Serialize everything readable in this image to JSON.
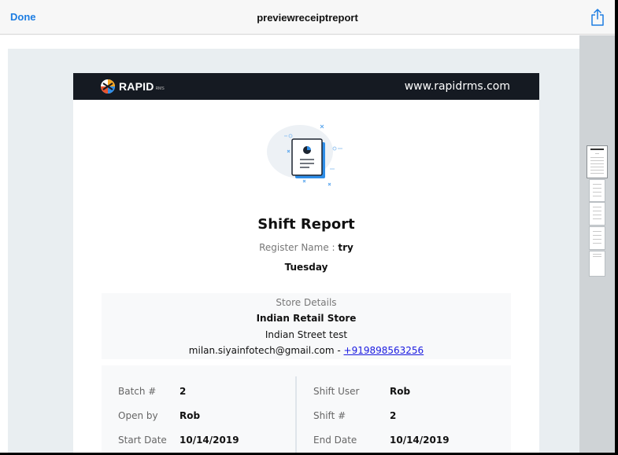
{
  "nav": {
    "done_label": "Done",
    "title": "previewreceiptreport",
    "share_icon": "share-icon"
  },
  "brand": {
    "logo_text": "RAPID",
    "logo_sub": "RMS",
    "website": "www.rapidrms.com"
  },
  "report": {
    "title": "Shift Report",
    "register_label": "Register Name :",
    "register_name": "try",
    "day": "Tuesday"
  },
  "store": {
    "heading": "Store Details",
    "name": "Indian Retail Store",
    "address": "Indian Street test",
    "email": "milan.siyainfotech@gmail.com",
    "separator": " - ",
    "phone": "+919898563256"
  },
  "details": {
    "left": [
      {
        "label": "Batch #",
        "value": "2"
      },
      {
        "label": "Open by",
        "value": "Rob"
      },
      {
        "label": "Start Date",
        "value": "10/14/2019"
      }
    ],
    "right": [
      {
        "label": "Shift User",
        "value": "Rob"
      },
      {
        "label": "Shift #",
        "value": "2"
      },
      {
        "label": "End Date",
        "value": "10/14/2019"
      }
    ]
  },
  "colors": {
    "accent": "#1d7de2",
    "brand_bar": "#151a22",
    "link": "#1a1ae0",
    "icon_blue": "#2f8ee8"
  }
}
